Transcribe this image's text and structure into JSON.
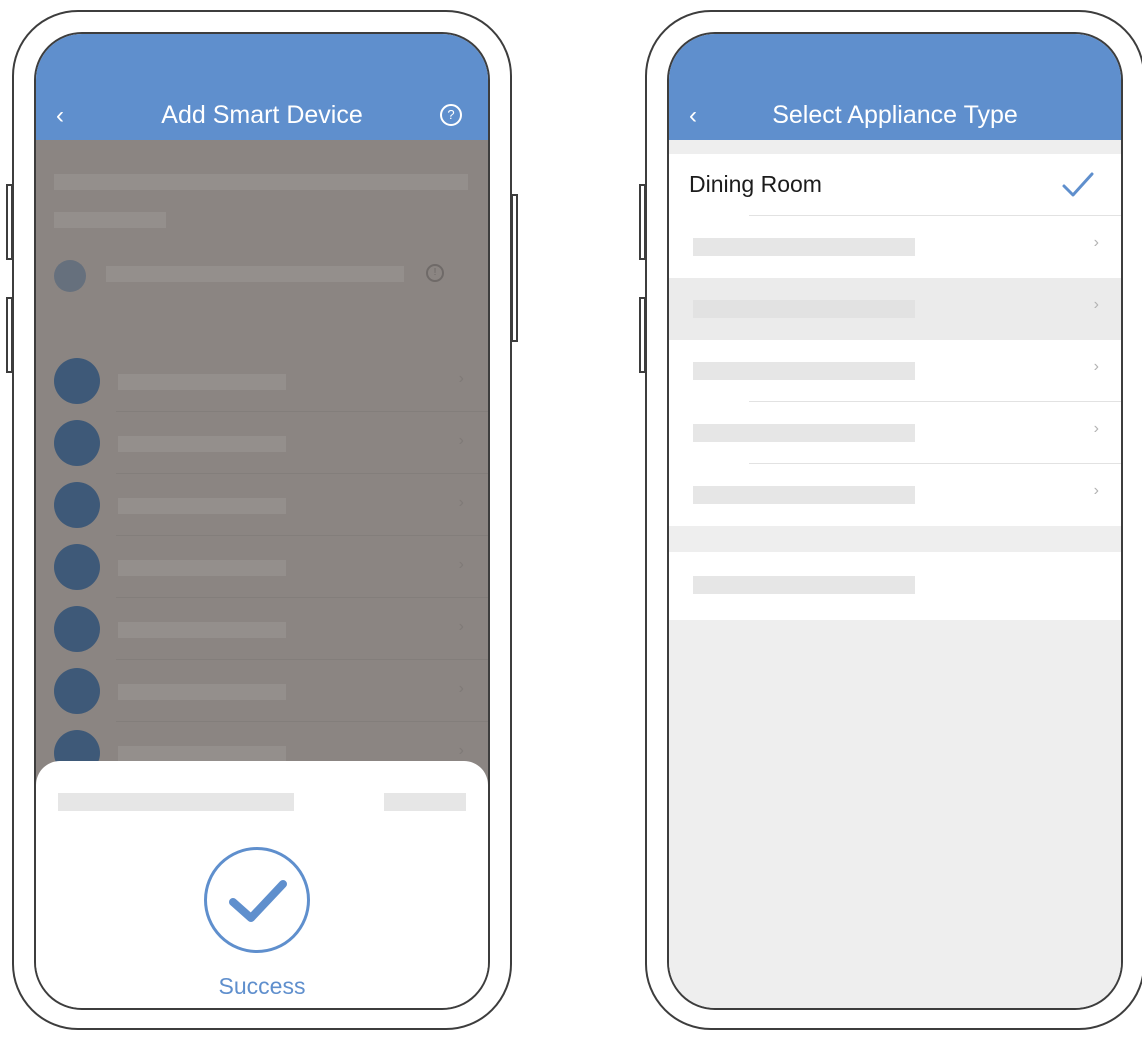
{
  "left_screen": {
    "header": {
      "title": "Add Smart Device",
      "back_icon": "chevron-left-icon",
      "help_icon": "question-circle-icon",
      "help_glyph": "?",
      "back_glyph": "‹"
    },
    "list_item_count": 7,
    "info_glyph": "!",
    "row_chevron": "›",
    "success_sheet": {
      "label": "Success",
      "icon": "check-circle-icon"
    }
  },
  "right_screen": {
    "header": {
      "title": "Select Appliance Type",
      "back_icon": "chevron-left-icon",
      "back_glyph": "‹"
    },
    "items": [
      {
        "label": "Dining Room",
        "selected": true
      },
      {
        "label": "",
        "selected": false
      },
      {
        "label": "",
        "selected": false
      },
      {
        "label": "",
        "selected": false
      },
      {
        "label": "",
        "selected": false
      },
      {
        "label": "",
        "selected": false
      }
    ],
    "extra_item": {
      "label": ""
    },
    "row_chevron": "›"
  },
  "colors": {
    "accent": "#5f8fcd",
    "overlay": "#8b8582",
    "device_icon": "#3e5978",
    "page_bg": "#eeeeee"
  }
}
